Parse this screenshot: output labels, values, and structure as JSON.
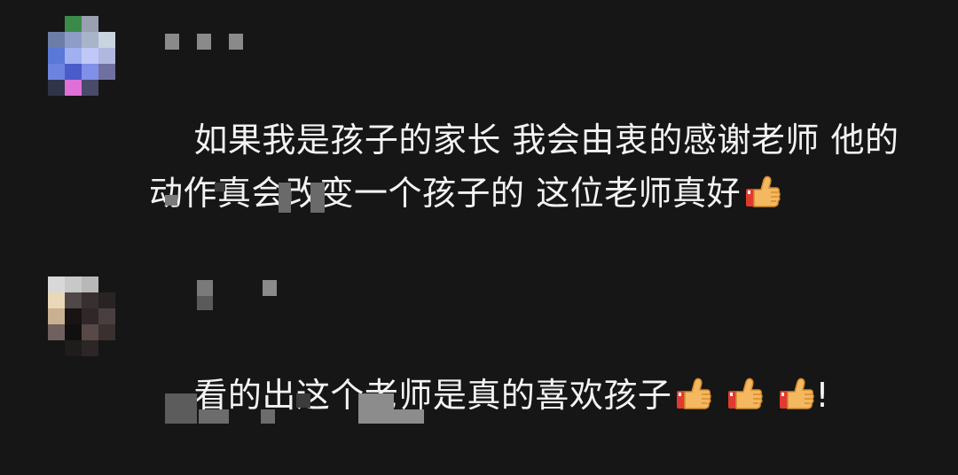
{
  "comments": [
    {
      "text": "如果我是孩子的家长 我会由衷的感谢老师 他的\n动作真会改变一个孩子的 这位老师真好",
      "emoji": [
        "thumbs-up-icon"
      ]
    },
    {
      "text": "看的出这个老师是真的喜欢孩子",
      "emoji": [
        "thumbs-up-icon",
        "thumbs-up-icon",
        "thumbs-up-icon"
      ],
      "suffix": "!"
    }
  ],
  "colors": {
    "background": "#161616",
    "text": "#f3f3f3",
    "thumb": "#f4b860",
    "cuff": "#e03a2f"
  }
}
